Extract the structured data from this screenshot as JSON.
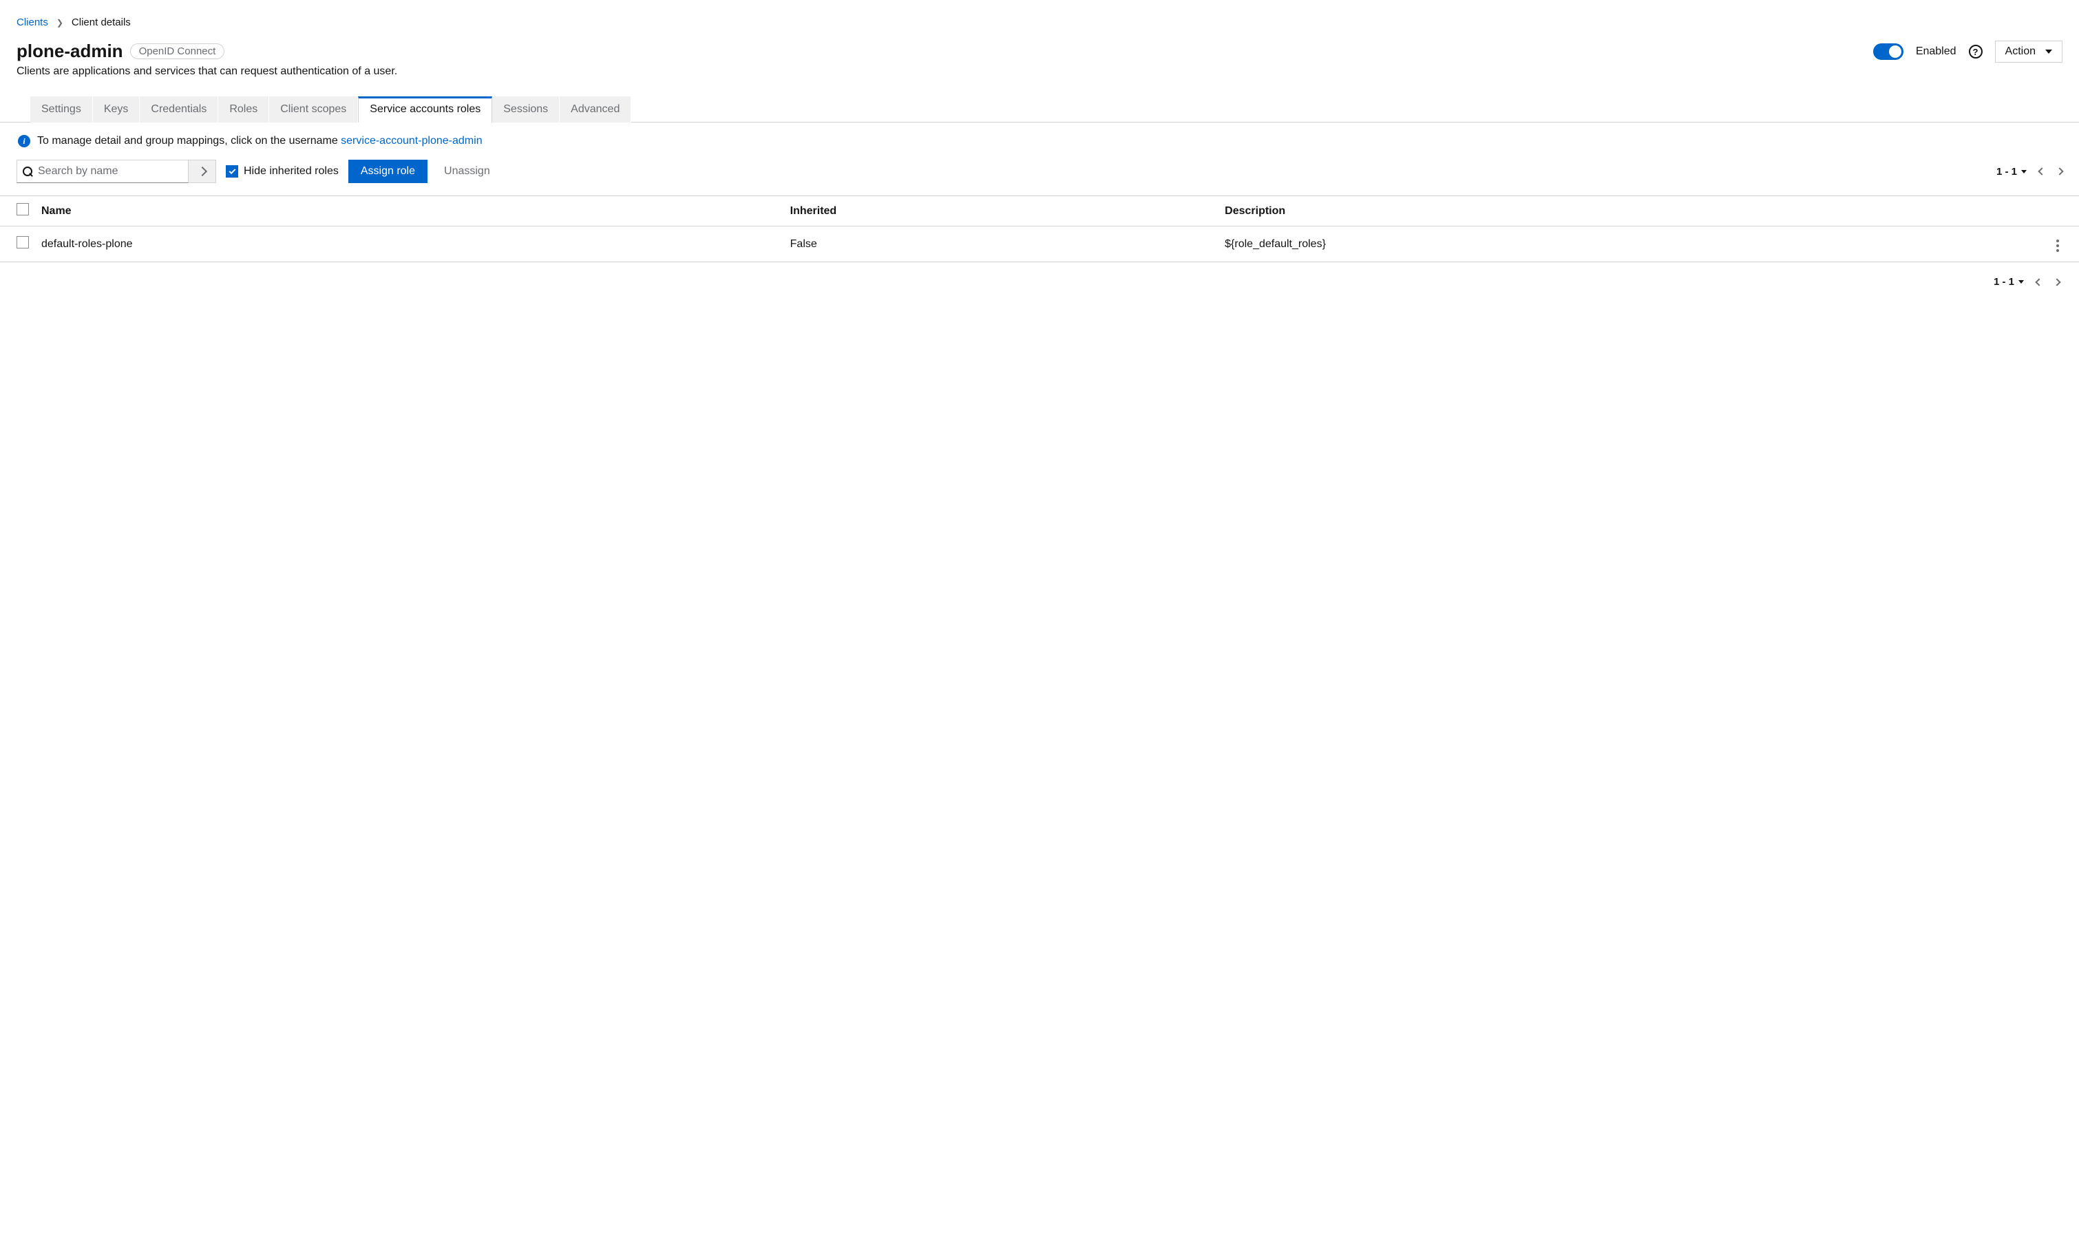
{
  "breadcrumb": {
    "root": "Clients",
    "current": "Client details"
  },
  "header": {
    "title": "plone-admin",
    "badge": "OpenID Connect",
    "subtitle": "Clients are applications and services that can request authentication of a user.",
    "enabled_label": "Enabled",
    "action_label": "Action"
  },
  "tabs": {
    "items": [
      "Settings",
      "Keys",
      "Credentials",
      "Roles",
      "Client scopes",
      "Service accounts roles",
      "Sessions",
      "Advanced"
    ],
    "active_index": 5
  },
  "info": {
    "text_prefix": "To manage detail and group mappings, click on the username ",
    "link_text": "service-account-plone-admin"
  },
  "toolbar": {
    "search_placeholder": "Search by name",
    "hide_inherited_label": "Hide inherited roles",
    "assign_label": "Assign role",
    "unassign_label": "Unassign"
  },
  "pagination": {
    "range": "1 - 1"
  },
  "table": {
    "columns": {
      "name": "Name",
      "inherited": "Inherited",
      "description": "Description"
    },
    "rows": [
      {
        "name": "default-roles-plone",
        "inherited": "False",
        "description": "${role_default_roles}"
      }
    ]
  }
}
